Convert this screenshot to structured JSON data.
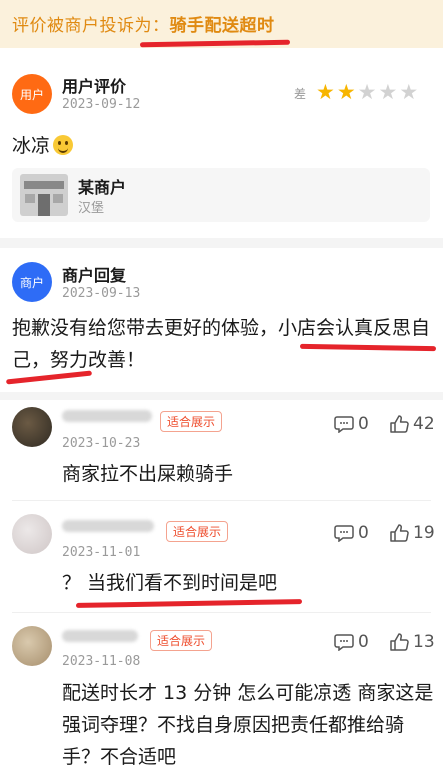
{
  "banner": {
    "prefix": "评价被商户投诉为：",
    "reason": "骑手配送超时"
  },
  "review": {
    "avatar_label": "用户",
    "title": "用户评价",
    "date": "2023-09-12",
    "rating_label": "差",
    "rating": 2,
    "rating_max": 5,
    "text": "冰凉",
    "emoji": "sweat-smile-emoji"
  },
  "merchant": {
    "name": "某商户",
    "category": "汉堡"
  },
  "reply": {
    "avatar_label": "商户",
    "title": "商户回复",
    "date": "2023-09-13",
    "text": "抱歉没有给您带去更好的体验，小店会认真反思自己，努力改善！"
  },
  "comments": [
    {
      "tag": "适合展示",
      "date": "2023-10-23",
      "replies": "0",
      "likes": "42",
      "text": "商家拉不出屎赖骑手"
    },
    {
      "tag": "适合展示",
      "date": "2023-11-01",
      "replies": "0",
      "likes": "19",
      "text": "？ 当我们看不到时间是吧"
    },
    {
      "tag": "适合展示",
      "date": "2023-11-08",
      "replies": "0",
      "likes": "13",
      "text": "配送时长才 13 分钟 怎么可能凉透 商家这是强词夺理？不找自身原因把责任都推给骑手？不合适吧"
    }
  ],
  "colors": {
    "accent_orange": "#e08a12",
    "highlight_red": "#e5242b",
    "star": "#f7b500",
    "merchant_blue": "#2e6cf6",
    "user_orange": "#ff6a13"
  }
}
